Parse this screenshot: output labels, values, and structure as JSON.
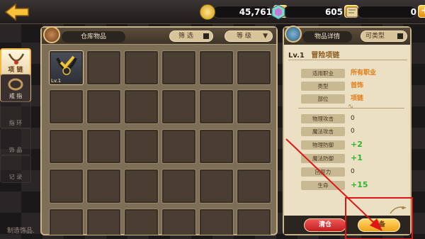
{
  "topbar": {
    "currencies": [
      {
        "icon": "gold-coin-icon",
        "value": "45,761",
        "plus": "+"
      },
      {
        "icon": "gem-icon",
        "value": "605",
        "plus": "+"
      },
      {
        "icon": "scroll-icon",
        "value": "0",
        "plus": "+"
      }
    ]
  },
  "sidebar": {
    "tabs": [
      {
        "label": "项 链",
        "state": "active"
      },
      {
        "label": "戒 指",
        "state": "on"
      },
      {
        "label": "指 环",
        "state": "off"
      },
      {
        "label": "饰 品",
        "state": "off"
      },
      {
        "label": "记 录",
        "state": "off"
      }
    ],
    "footer": "制造饰品."
  },
  "warehouse": {
    "title": "仓库物品",
    "filter_label": "筛 选",
    "sort_label": "等 级",
    "item_level": "Lv.1"
  },
  "detail": {
    "title": "物品详情",
    "compare_label": "可类型",
    "item_level": "Lv.1",
    "item_name": "冒险项链",
    "info": [
      {
        "key": "适用职业",
        "value": "所有职业"
      },
      {
        "key": "类型",
        "value": "首饰"
      },
      {
        "key": "部位",
        "value": "项链"
      }
    ],
    "stats": [
      {
        "key": "物理攻击",
        "value": "0",
        "style": "plain"
      },
      {
        "key": "魔法攻击",
        "value": "0",
        "style": "plain"
      },
      {
        "key": "物理防御",
        "value": "+2",
        "style": "green"
      },
      {
        "key": "魔法防御",
        "value": "+1",
        "style": "green"
      },
      {
        "key": "回复力",
        "value": "0",
        "style": "plain"
      },
      {
        "key": "生命",
        "value": "+15",
        "style": "green"
      }
    ],
    "clear_button": "清仓",
    "equip_button": "装备"
  },
  "colors": {
    "accent_red": "#e01515",
    "stat_green": "#2fb52f",
    "value_orange": "#e27a12"
  }
}
